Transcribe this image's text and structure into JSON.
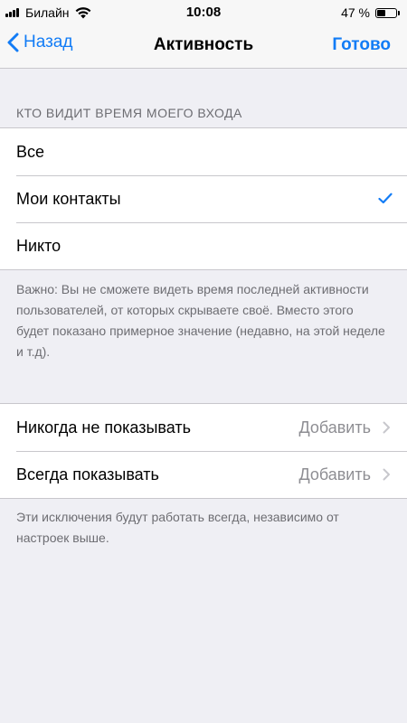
{
  "status_bar": {
    "carrier": "Билайн",
    "time": "10:08",
    "battery_percent": "47 %",
    "battery_level": 0.47,
    "signal_icon": "cellular-signal-icon",
    "wifi_icon": "wifi-icon",
    "battery_icon": "battery-icon"
  },
  "nav": {
    "back_label": "Назад",
    "title": "Активность",
    "done_label": "Готово",
    "back_icon": "chevron-left-icon"
  },
  "visibility_section": {
    "header": "КТО ВИДИТ ВРЕМЯ МОЕГО ВХОДА",
    "options": [
      {
        "label": "Все",
        "selected": false
      },
      {
        "label": "Мои контакты",
        "selected": true
      },
      {
        "label": "Никто",
        "selected": false
      }
    ],
    "footer": "Важно: Вы не сможете видеть время последней активности пользователей, от которых скрываете своё. Вместо этого будет показано примерное значение (недавно, на этой неделе и т.д)."
  },
  "exceptions_section": {
    "rows": [
      {
        "label": "Никогда не показывать",
        "value": "Добавить"
      },
      {
        "label": "Всегда показывать",
        "value": "Добавить"
      }
    ],
    "footer": "Эти исключения будут работать всегда, независимо от настроек выше."
  },
  "colors": {
    "accent": "#127cf6",
    "background": "#efeff4",
    "secondary_text": "#6d6d72",
    "value_text": "#8e8e93"
  }
}
